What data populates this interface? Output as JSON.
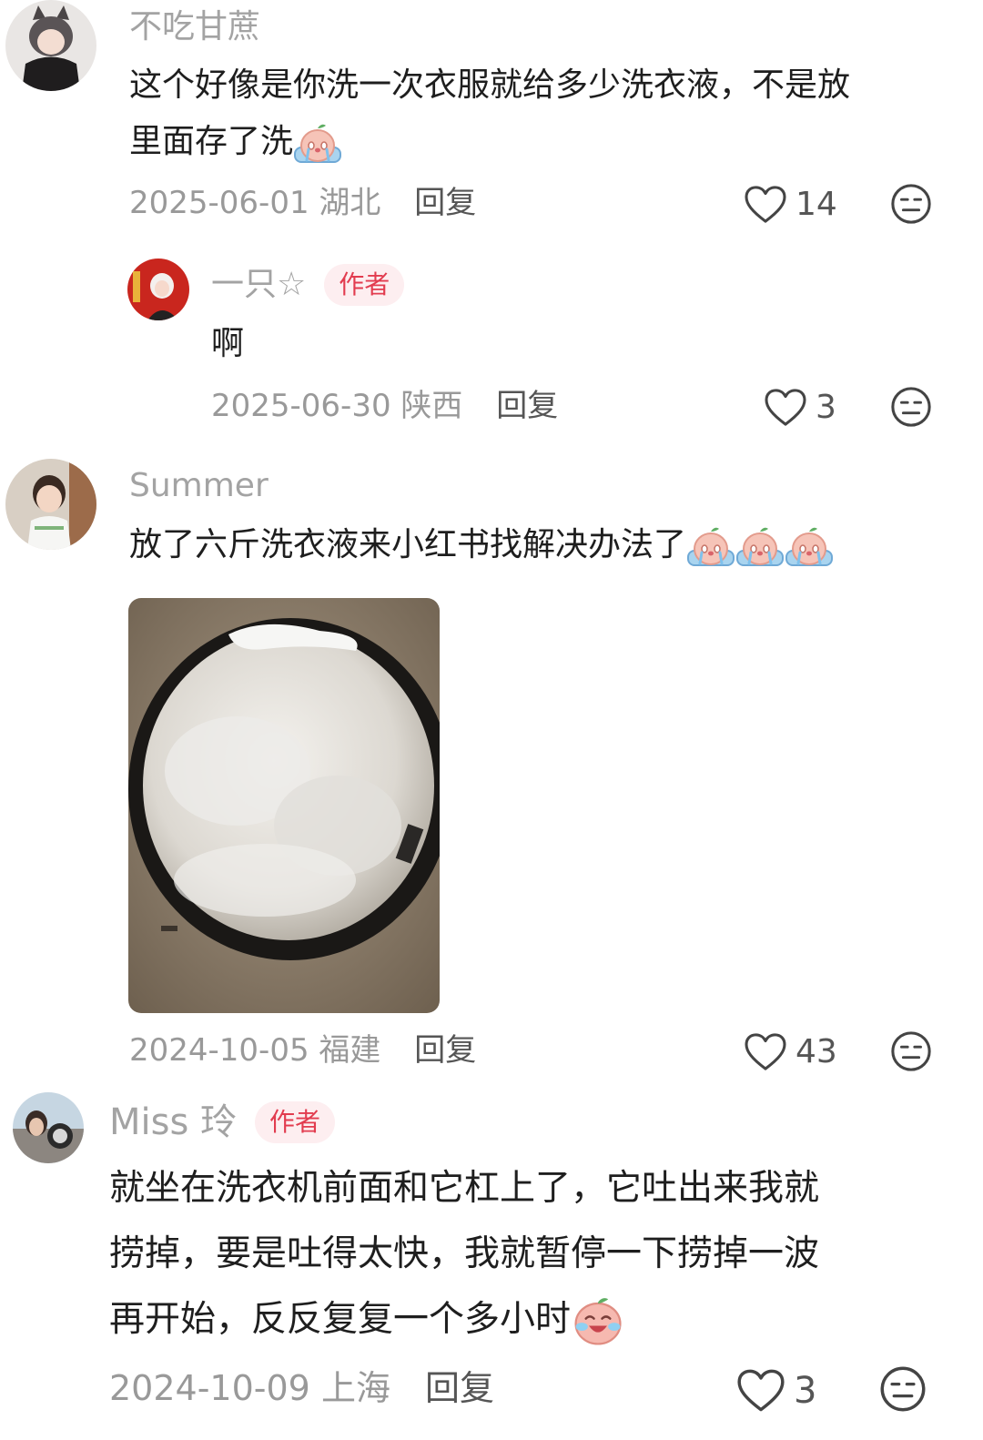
{
  "comments": [
    {
      "username": "不吃甘蔗",
      "text_lines": [
        "这个好像是你洗一次衣服就给多少洗衣液，不是放",
        "里面存了洗"
      ],
      "emoji": "crying-emoji",
      "date": "2025-06-01",
      "location": "湖北",
      "reply_label": "回复",
      "likes": "14"
    },
    {
      "username": "一只☆",
      "author_tag": "作者",
      "text": "啊",
      "date": "2025-06-30",
      "location": "陕西",
      "reply_label": "回复",
      "likes": "3"
    },
    {
      "username": "Summer",
      "text": "放了六斤洗衣液来小红书找解决办法了",
      "emoji": "crying-emoji",
      "emoji_count": 3,
      "image": "washing-machine-foam-photo",
      "date": "2024-10-05",
      "location": "福建",
      "reply_label": "回复",
      "likes": "43"
    },
    {
      "username": "Miss 玲",
      "author_tag": "作者",
      "text_lines": [
        "就坐在洗衣机前面和它杠上了，它吐出来我就",
        "捞掉，要是吐得太快，我就暂停一下捞掉一波",
        "再开始，反反复复一个多小时"
      ],
      "emoji": "laugh-cry-emoji",
      "date": "2024-10-09",
      "location": "上海",
      "reply_label": "回复",
      "likes": "3"
    }
  ],
  "icons": {
    "like": "heart-icon",
    "dislike": "neutral-face-icon"
  },
  "colors": {
    "author_tag_text": "#e23c4f",
    "author_tag_bg": "#fdeef0",
    "username": "#a3a3a3",
    "meta": "#999999"
  }
}
